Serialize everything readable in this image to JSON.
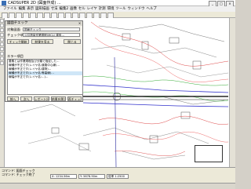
{
  "window": {
    "title": "CADSUPER 2D (図面作成) ...",
    "controls": [
      "_",
      "□",
      "×"
    ]
  },
  "menu": {
    "items": [
      "ファイル",
      "編集",
      "表示",
      "図形描画",
      "寸法",
      "編集2",
      "画像",
      "セル",
      "レイヤ",
      "計測",
      "環境",
      "ツール",
      "ウィンドウ",
      "ヘルプ"
    ]
  },
  "panel": {
    "title": "図面チェック",
    "row1_label": "対象図面",
    "row1_value": "図面チェック",
    "row2_label": "チェック項目",
    "row2_value": "公共測量作業規程(MCL) 建設...",
    "buttons_top": [
      "チェック開始",
      "結果を見る",
      "閉じる"
    ],
    "section_label": "エラー項目",
    "errors": [
      "要素とは作業規程及び分類で指定した...",
      "線種が不正です(レイヤ名:道路中心線)…",
      "線種が不正です(レイヤ名:建物)…",
      "線種が不正です(レイヤ名:等高線)…",
      "線幅が不正です(レイヤ名:...)…"
    ],
    "buttons_bottom": [
      "前へ",
      "次へ",
      "レポート出力",
      "結果を閉じる",
      "再チェック"
    ]
  },
  "status": {
    "line1": "コマンド: 図面チェック",
    "line2": "コマンド: チェック終了",
    "fields": [
      "X: 1234.56m",
      "Y: 5678.90m",
      "倍率 1:2500"
    ]
  }
}
